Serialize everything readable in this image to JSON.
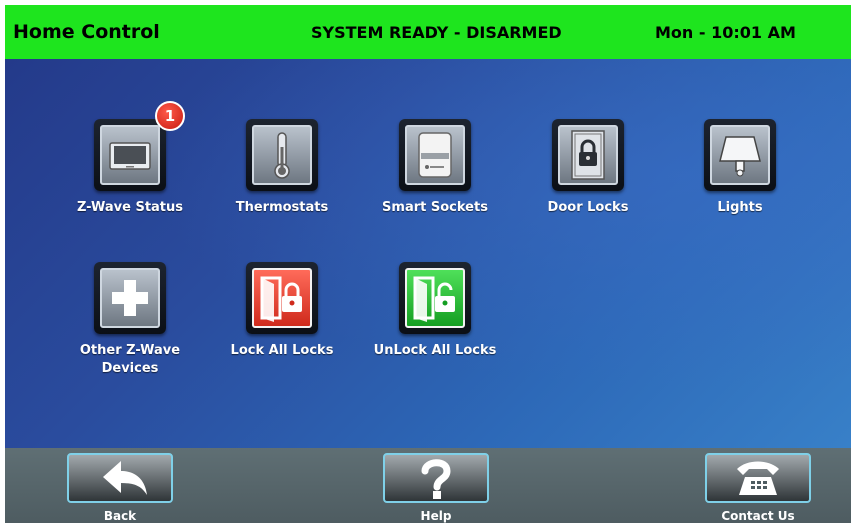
{
  "header": {
    "title": "Home Control",
    "status": "SYSTEM READY - DISARMED",
    "clock": "Mon - 10:01 AM"
  },
  "tiles": [
    {
      "label": "Z-Wave Status",
      "icon": "tablet-icon",
      "badge": "1"
    },
    {
      "label": "Thermostats",
      "icon": "thermometer-icon"
    },
    {
      "label": "Smart Sockets",
      "icon": "smart-socket-icon"
    },
    {
      "label": "Door Locks",
      "icon": "door-lock-icon"
    },
    {
      "label": "Lights",
      "icon": "lamp-icon"
    },
    {
      "label_line1": "Other Z-Wave",
      "label_line2": "Devices",
      "icon": "plus-icon"
    },
    {
      "label": "Lock All Locks",
      "icon": "door-locked-icon"
    },
    {
      "label": "UnLock All Locks",
      "icon": "door-unlocked-icon"
    }
  ],
  "footer": {
    "back": {
      "label": "Back",
      "icon": "back-arrow-icon"
    },
    "help": {
      "label": "Help",
      "icon": "question-icon"
    },
    "contact": {
      "label": "Contact Us",
      "icon": "telephone-icon"
    }
  },
  "colors": {
    "header_bg": "#1ee51e",
    "main_bg_start": "#243a8a",
    "main_bg_end": "#3880c8",
    "footer_bg": "#56656a",
    "lock_all": "#e8402f",
    "unlock_all": "#2cc33a",
    "badge": "#e02a1c"
  }
}
